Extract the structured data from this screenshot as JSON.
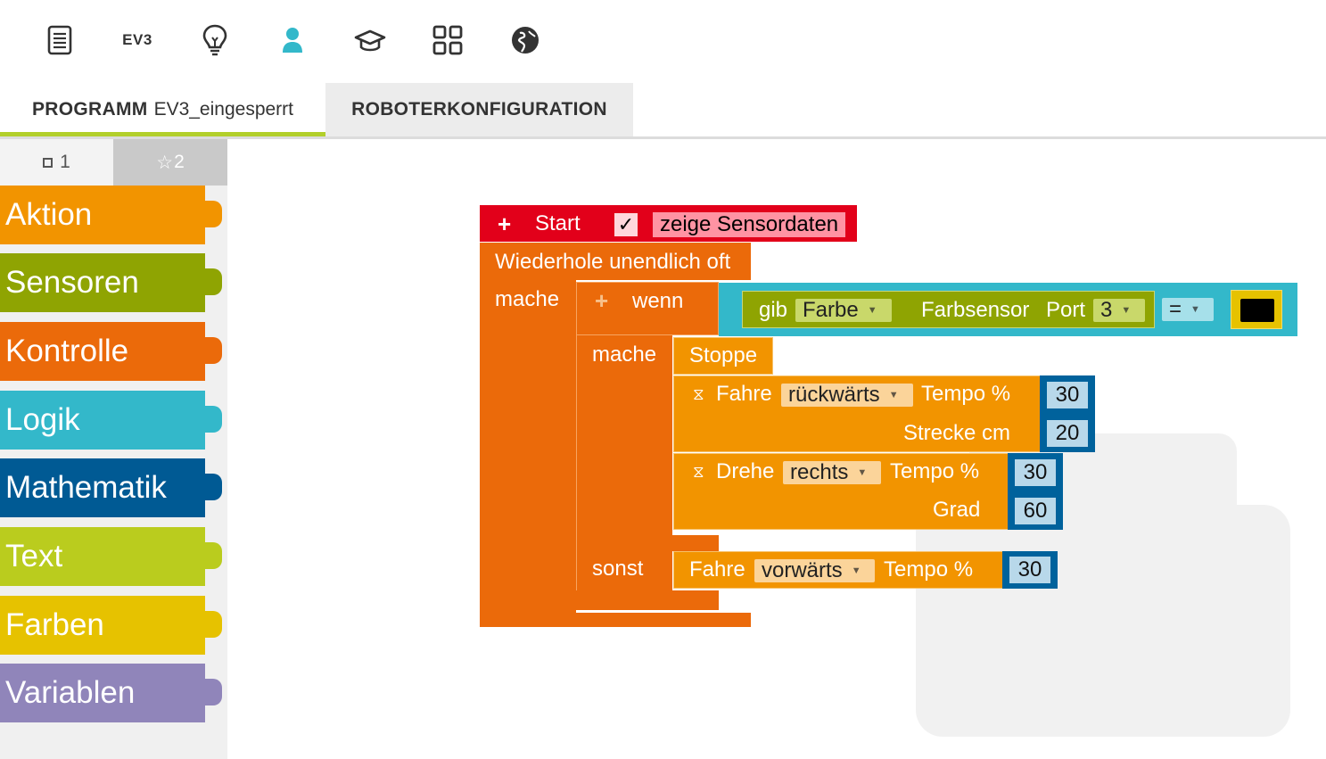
{
  "topbar": {
    "icons": [
      "program-icon",
      "ev3-icon",
      "lightbulb-icon",
      "user-icon",
      "graduation-cap-icon",
      "gallery-icon",
      "globe-icon"
    ],
    "ev3_label": "EV3"
  },
  "tabs": {
    "program_prefix": "PROGRAMM",
    "program_name": "EV3_eingesperrt",
    "robot": "ROBOTERKONFIGURATION"
  },
  "toolbox": {
    "level1": "1",
    "level2": "2",
    "categories": [
      {
        "label": "Aktion",
        "color": "#f29400"
      },
      {
        "label": "Sensoren",
        "color": "#8fa402"
      },
      {
        "label": "Kontrolle",
        "color": "#eb6a0a"
      },
      {
        "label": "Logik",
        "color": "#33b8ca"
      },
      {
        "label": "Mathematik",
        "color": "#005a94"
      },
      {
        "label": "Text",
        "color": "#bacc1e"
      },
      {
        "label": "Farben",
        "color": "#e6c200"
      },
      {
        "label": "Variablen",
        "color": "#9085ba"
      }
    ]
  },
  "program": {
    "start": {
      "label": "Start",
      "checkbox": "✓",
      "sensor_label": "zeige Sensordaten"
    },
    "loop": {
      "label": "Wiederhole unendlich oft",
      "do": "mache"
    },
    "if": {
      "label": "wenn",
      "do": "mache",
      "else": "sonst"
    },
    "condition": {
      "get": "gib",
      "get_value": "Farbe",
      "sensor": "Farbsensor",
      "port_label": "Port",
      "port_value": "3",
      "operator": "="
    },
    "stop": "Stoppe",
    "drive1": {
      "label": "Fahre",
      "direction": "rückwärts",
      "speed_label": "Tempo %",
      "speed": "30",
      "dist_label": "Strecke cm",
      "dist": "20"
    },
    "turn": {
      "label": "Drehe",
      "direction": "rechts",
      "speed_label": "Tempo %",
      "speed": "30",
      "deg_label": "Grad",
      "deg": "60"
    },
    "drive2": {
      "label": "Fahre",
      "direction": "vorwärts",
      "speed_label": "Tempo %",
      "speed": "30"
    }
  },
  "colors": {
    "start": "#e2001a",
    "control": "#eb6a0a",
    "action": "#f29400",
    "logic": "#33b8ca",
    "sensor": "#8fa402",
    "math": "#005a94",
    "color_black": "#000000",
    "tab_accent": "#b2cf2a"
  }
}
